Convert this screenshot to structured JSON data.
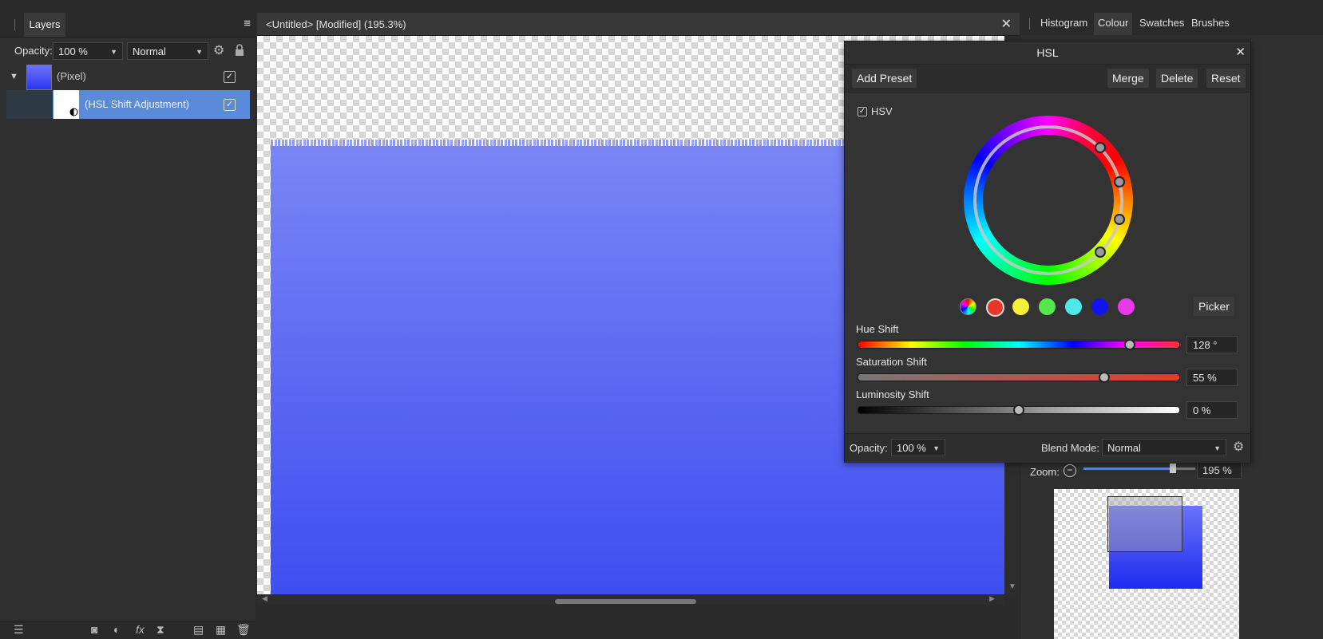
{
  "layers_panel": {
    "tab": "Layers",
    "opacity_label": "Opacity:",
    "opacity_value": "100 %",
    "blend_mode": "Normal",
    "layers": [
      {
        "name": "(Pixel)",
        "visible": true
      },
      {
        "name": "(HSL Shift Adjustment)",
        "visible": true,
        "selected": true
      }
    ]
  },
  "document": {
    "title": "<Untitled> [Modified] (195.3%)"
  },
  "right_panel": {
    "tabs": [
      "Histogram",
      "Colour",
      "Swatches",
      "Brushes"
    ],
    "active_tab": "Colour",
    "zoom_label": "Zoom:",
    "zoom_value": "195 %"
  },
  "hsl_dialog": {
    "title": "HSL",
    "buttons": {
      "add_preset": "Add Preset",
      "merge": "Merge",
      "delete": "Delete",
      "reset": "Reset"
    },
    "hsv_label": "HSV",
    "hsv_checked": true,
    "picker_label": "Picker",
    "swatch_colors": [
      "#e8372a",
      "#f5ef3a",
      "#56e84a",
      "#4fe8e8",
      "#1414f0",
      "#e83ae8"
    ],
    "hue_shift": {
      "label": "Hue Shift",
      "value": "128 °",
      "fraction": 0.845
    },
    "saturation_shift": {
      "label": "Saturation Shift",
      "value": "55 %",
      "fraction": 0.765
    },
    "luminosity_shift": {
      "label": "Luminosity Shift",
      "value": "0 %",
      "fraction": 0.5
    },
    "opacity_label": "Opacity:",
    "opacity_value": "100 %",
    "blend_mode_label": "Blend Mode:",
    "blend_mode_value": "Normal"
  },
  "colors": {
    "selection": "#5b8ad8",
    "pixel_top": "#7a85f5",
    "pixel_bottom": "#3f4ef0"
  }
}
